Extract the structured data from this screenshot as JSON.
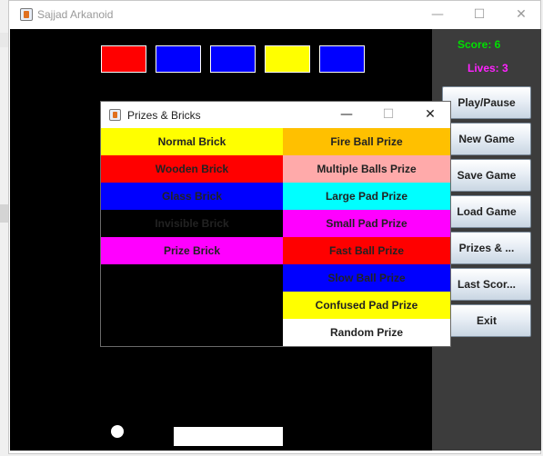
{
  "window": {
    "title": "Sajjad Arkanoid",
    "minimize": "—",
    "maximize": "☐",
    "close": "✕"
  },
  "hud": {
    "score": "Score: 6",
    "lives": "Lives: 3"
  },
  "buttons": [
    "Play/Pause",
    "New Game",
    "Save Game",
    "Load Game",
    "Prizes & ...",
    "Last Scor...",
    "Exit"
  ],
  "bricks": [
    {
      "color": "#ff0000"
    },
    {
      "color": "#0000ff"
    },
    {
      "color": "#0000ff"
    },
    {
      "color": "#ffff00"
    },
    {
      "color": "#0000ff"
    }
  ],
  "dialog": {
    "title": "Prizes & Bricks",
    "minimize": "—",
    "maximize": "☐",
    "close": "✕",
    "brick_types": [
      {
        "label": "Normal Brick",
        "bg": "#ffff00"
      },
      {
        "label": "Wooden Brick",
        "bg": "#ff0000"
      },
      {
        "label": "Glass Brick",
        "bg": "#0000ff"
      },
      {
        "label": "Invisible Brick",
        "bg": "#000000"
      },
      {
        "label": "Prize Brick",
        "bg": "#ff00ff"
      }
    ],
    "prize_types": [
      {
        "label": "Fire Ball Prize",
        "bg": "#ffc000"
      },
      {
        "label": "Multiple Balls Prize",
        "bg": "#ffaaaa"
      },
      {
        "label": "Large Pad Prize",
        "bg": "#00ffff"
      },
      {
        "label": "Small Pad Prize",
        "bg": "#ff00ff"
      },
      {
        "label": "Fast Ball Prize",
        "bg": "#ff0000"
      },
      {
        "label": "Slow Ball Prize",
        "bg": "#0000ff"
      },
      {
        "label": "Confused Pad Prize",
        "bg": "#ffff00"
      },
      {
        "label": "Random Prize",
        "bg": "#ffffff"
      }
    ]
  }
}
